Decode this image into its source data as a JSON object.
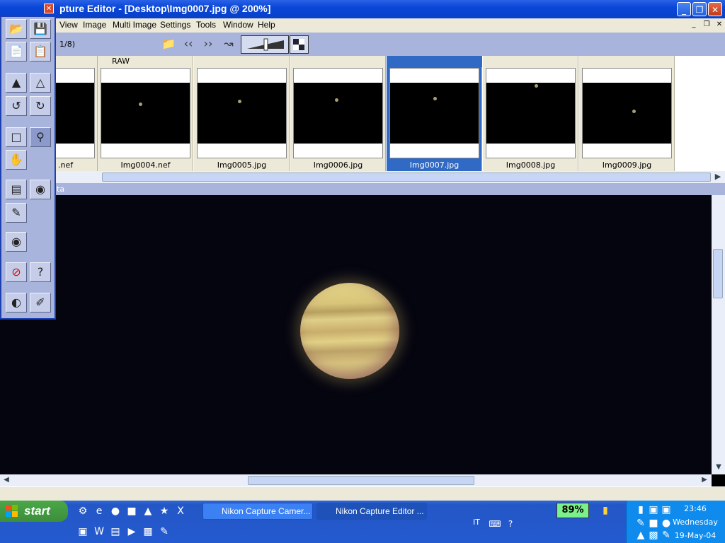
{
  "window": {
    "title": "pture Editor - [Desktop\\Img0007.jpg @ 200%]",
    "minimize_glyph": "_",
    "restore_glyph": "❐",
    "close_glyph": "✕"
  },
  "menu": {
    "items": [
      "View",
      "Image",
      "Multi Image",
      "Settings",
      "Tools",
      "Window",
      "Help"
    ],
    "mdi_min": "_",
    "mdi_restore": "❐",
    "mdi_close": "✕"
  },
  "toolbar": {
    "counter": "1/8)",
    "icons": [
      "folder-icon",
      "prev-icon",
      "next-icon",
      "rotate-icon",
      "zoom-slider-icon",
      "checker-icon"
    ]
  },
  "thumbnails": [
    {
      "header": "",
      "caption": ".nef",
      "selected": false,
      "dot": {
        "x": null,
        "y": null
      }
    },
    {
      "header": "RAW",
      "caption": "Img0004.nef",
      "selected": false
    },
    {
      "header": "",
      "caption": "Img0005.jpg",
      "selected": false
    },
    {
      "header": "",
      "caption": "Img0006.jpg",
      "selected": false
    },
    {
      "header": "",
      "caption": "Img0007.jpg",
      "selected": true
    },
    {
      "header": "",
      "caption": "Img0008.jpg",
      "selected": false
    },
    {
      "header": "",
      "caption": "Img0009.jpg",
      "selected": false
    }
  ],
  "infobar": {
    "text": "ta"
  },
  "palette": {
    "close_glyph": "✕",
    "tools": [
      "open-icon",
      "save-icon",
      "copy-icon",
      "paste-icon",
      "levels-icon",
      "curves-icon",
      "rotate-left-icon",
      "rotate-right-icon",
      "marquee-icon",
      "zoom-icon",
      "hand-icon",
      "window-icon",
      "camera-icon",
      "notes-icon",
      "eye-icon",
      "stop-icon",
      "help-icon",
      "contrast-icon",
      "brush-icon"
    ]
  },
  "taskbar": {
    "start_label": "start",
    "tasks": [
      {
        "label": "Nikon Capture Camer...",
        "active": false
      },
      {
        "label": "Nikon Capture Editor ...",
        "active": true
      }
    ],
    "language": "IT",
    "battery": "89%",
    "clock": {
      "time": "23:46",
      "day": "Wednesday",
      "date": "19-May-04"
    }
  }
}
